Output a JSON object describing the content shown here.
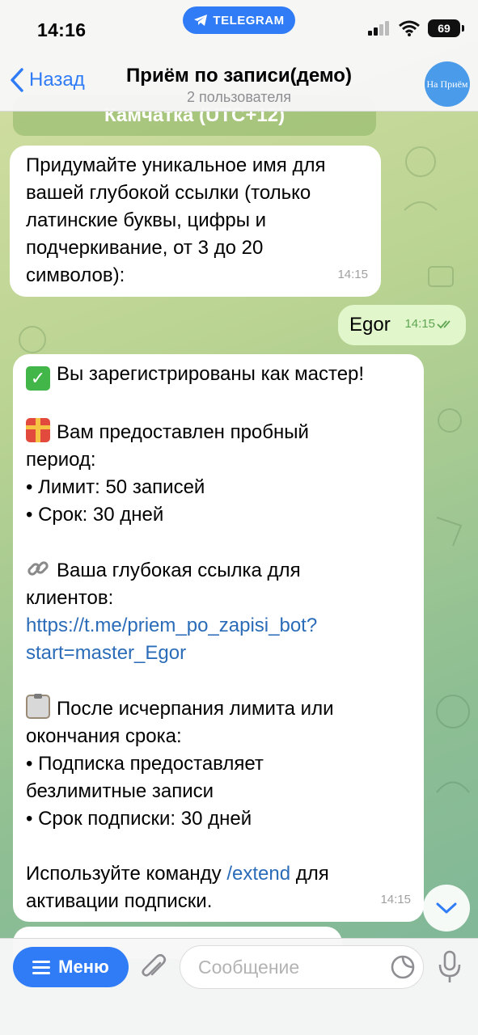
{
  "status_bar": {
    "time": "14:16",
    "telegram_label": "TELEGRAM",
    "battery": "69"
  },
  "header": {
    "back_label": "Назад",
    "title": "Приём по записи(демо)",
    "subtitle": "2 пользователя",
    "avatar_text": "На Приём"
  },
  "messages": {
    "inline_button": "Камчатка (UTC+12)",
    "bot_prompt": {
      "lines": [
        "Придумайте уникальное имя для",
        "вашей глубокой ссылки (только",
        "латинские буквы, цифры и",
        "подчеркивание, от 3 до 20",
        "символов):"
      ],
      "time": "14:15"
    },
    "user_reply": {
      "text": "Egor",
      "time": "14:15"
    },
    "bot_confirm": {
      "line_registered": "Вы зарегистрированы как мастер!",
      "line_trial_1": "Вам предоставлен пробный",
      "line_trial_2": "период:",
      "line_limit": "• Лимит: 50 записей",
      "line_term": "• Срок: 30 дней",
      "line_link_1": "Ваша глубокая ссылка для",
      "line_link_2": "клиентов:",
      "link_1": "https://t.me/priem_po_zapisi_bot?",
      "link_2": "start=master_Egor",
      "line_after_1": "После исчерпания лимита или",
      "line_after_2": "окончания срока:",
      "line_sub_1": "• Подписка предоставляет",
      "line_sub_2": "безлимитные записи",
      "line_sub_term": "• Срок подписки: 30 дней",
      "line_use_pre": "Используйте команду ",
      "line_use_cmd": "/extend",
      "line_use_post": " для",
      "line_use_2": "активации подписки.",
      "time": "14:15"
    }
  },
  "input_bar": {
    "menu_label": "Меню",
    "placeholder": "Сообщение"
  },
  "icons": [
    "telegram-icon",
    "signal-icon",
    "wifi-icon",
    "battery-icon",
    "chevron-left-icon",
    "check-emoji",
    "gift-emoji",
    "link-emoji",
    "clipboard-emoji",
    "double-check-icon",
    "chevron-down-icon",
    "menu-icon",
    "paperclip-icon",
    "sticker-icon",
    "microphone-icon"
  ],
  "colors": {
    "accent": "#2f7cf6",
    "link": "#2b6cb8",
    "outgoing_bubble": "#e1f7cb",
    "read_check": "#5fa553"
  }
}
